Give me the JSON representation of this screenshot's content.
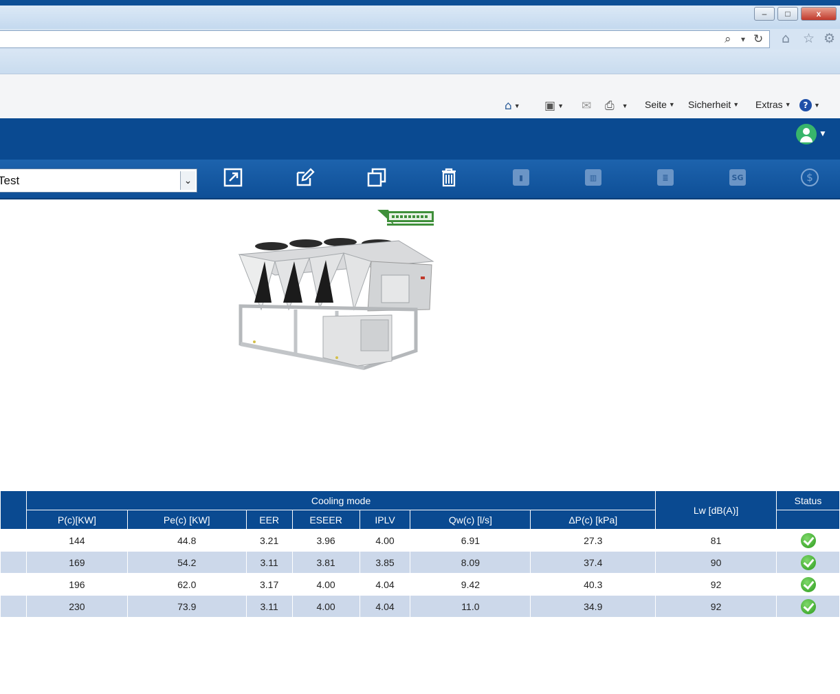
{
  "browser": {
    "window_controls": {
      "minimize": "–",
      "maximize": "□",
      "close": "x"
    },
    "address_icons": {
      "search": "⌕",
      "dropdown": "▾",
      "refresh": "↻"
    },
    "chrome_icons": [
      "home-icon",
      "star-icon",
      "gear-icon"
    ],
    "command_bar": {
      "seite": "Seite",
      "sicherheit": "Sicherheit",
      "extras": "Extras"
    }
  },
  "app": {
    "header_color": "#0a4a91",
    "selector": {
      "value": "Test"
    },
    "toolbar_icons": [
      "export-icon",
      "edit-icon",
      "copy-icon",
      "delete-icon",
      "lock-icon",
      "chart-icon",
      "document-icon",
      "sg-icon",
      "currency-icon"
    ],
    "toolbar_sg_label": "SG",
    "toolbar_currency_label": "$"
  },
  "table": {
    "group_header": "Cooling mode",
    "columns": [
      "P(c)[KW]",
      "Pe(c) [KW]",
      "EER",
      "ESEER",
      "IPLV",
      "Qw(c) [l/s]",
      "ΔP(c) [kPa]"
    ],
    "lw_header": "Lw [dB(A)]",
    "status_header": "Status",
    "rows": [
      [
        "144",
        "44.8",
        "3.21",
        "3.96",
        "4.00",
        "6.91",
        "27.3",
        "81"
      ],
      [
        "169",
        "54.2",
        "3.11",
        "3.81",
        "3.85",
        "8.09",
        "37.4",
        "90"
      ],
      [
        "196",
        "62.0",
        "3.17",
        "4.00",
        "4.04",
        "9.42",
        "40.3",
        "92"
      ],
      [
        "230",
        "73.9",
        "3.11",
        "4.00",
        "4.04",
        "11.0",
        "34.9",
        "92"
      ]
    ]
  }
}
